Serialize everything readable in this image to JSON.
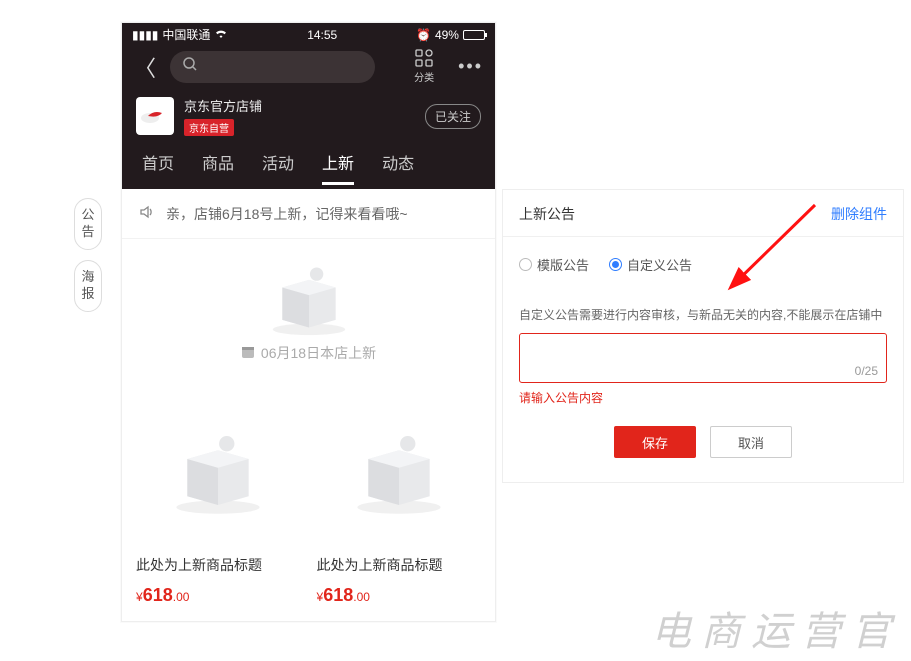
{
  "status_bar": {
    "carrier": "中国联通",
    "time": "14:55",
    "battery_pct": "49%"
  },
  "phone_nav": {
    "category_label": "分类"
  },
  "store": {
    "name": "京东官方店铺",
    "tag": "京东自营",
    "follow": "已关注"
  },
  "tabs": [
    "首页",
    "商品",
    "活动",
    "上新",
    "动态"
  ],
  "active_tab_index": 3,
  "notice": {
    "text": "亲，店铺6月18号上新，记得来看看哦~"
  },
  "date_line": "06月18日本店上新",
  "products": [
    {
      "title": "此处为上新商品标题",
      "currency": "¥",
      "price_big": "618",
      "price_small": ".00"
    },
    {
      "title": "此处为上新商品标题",
      "currency": "¥",
      "price_big": "618",
      "price_small": ".00"
    }
  ],
  "side_pills": [
    "公告",
    "海报"
  ],
  "panel": {
    "title": "上新公告",
    "delete": "删除组件",
    "radio_template": "模版公告",
    "radio_custom": "自定义公告",
    "helper": "自定义公告需要进行内容审核，与新品无关的内容,不能展示在店铺中",
    "counter": "0/25",
    "error": "请输入公告内容",
    "save": "保存",
    "cancel": "取消"
  },
  "watermark": "电商运营官"
}
